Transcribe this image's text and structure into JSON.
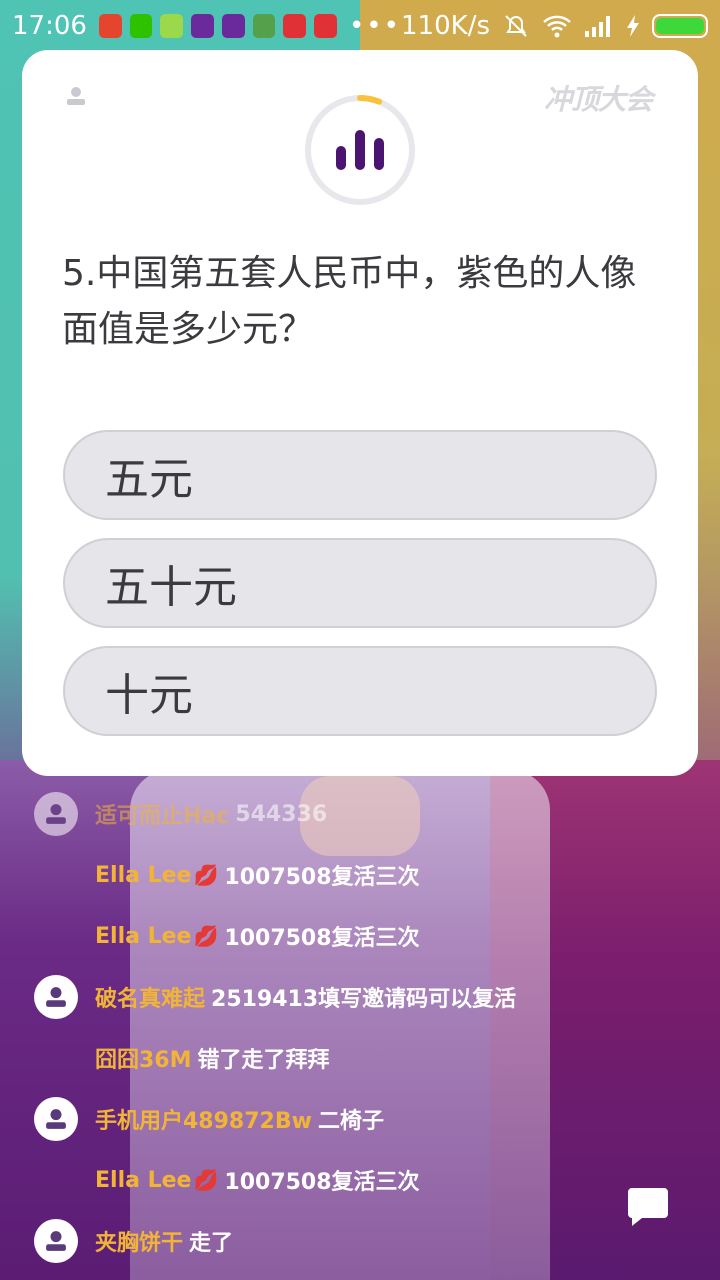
{
  "status_bar": {
    "time": "17:06",
    "more": "•••",
    "speed": "110K/s",
    "icons": [
      "weibo-icon",
      "wechat-icon",
      "sim-icon",
      "chongding-icon",
      "chongding-icon",
      "android-icon",
      "video-icon",
      "video-icon"
    ],
    "right_icons": [
      "silent-icon",
      "wifi-icon",
      "signal-icon",
      "charging-icon",
      "battery-icon"
    ],
    "battery_level": 1.0,
    "battery_color": "#3fd83a"
  },
  "card": {
    "logo": "冲顶大会",
    "timer_progress": 0.06,
    "timer_color": "#f8c33b",
    "question": "5.中国第五套人民币中，紫色的人像面值是多少元？",
    "options": [
      {
        "label": "五元"
      },
      {
        "label": "五十元"
      },
      {
        "label": "十元"
      }
    ]
  },
  "comments": [
    {
      "name": "适可而止Hac",
      "text": "544336",
      "has_avatar": true
    },
    {
      "name": "Ella Lee",
      "text": "1007508复活三次",
      "has_avatar": false,
      "emoji": "kiss"
    },
    {
      "name": "Ella Lee",
      "text": "1007508复活三次",
      "has_avatar": false,
      "emoji": "kiss"
    },
    {
      "name": "破名真难起",
      "text": "2519413填写邀请码可以复活",
      "has_avatar": true
    },
    {
      "name": "囧囧36M",
      "text": "错了走了拜拜",
      "has_avatar": false
    },
    {
      "name": "手机用户489872Bw",
      "text": "二椅子",
      "has_avatar": true
    },
    {
      "name": "Ella Lee",
      "text": "1007508复活三次",
      "has_avatar": false,
      "emoji": "kiss"
    },
    {
      "name": "夹胸饼干",
      "text": "走了",
      "has_avatar": true
    }
  ],
  "colors": {
    "name": "#f2b437",
    "comment_text": "#ffffff",
    "option_bg": "#e6e5ea",
    "timer_bars": "#4a1470"
  }
}
